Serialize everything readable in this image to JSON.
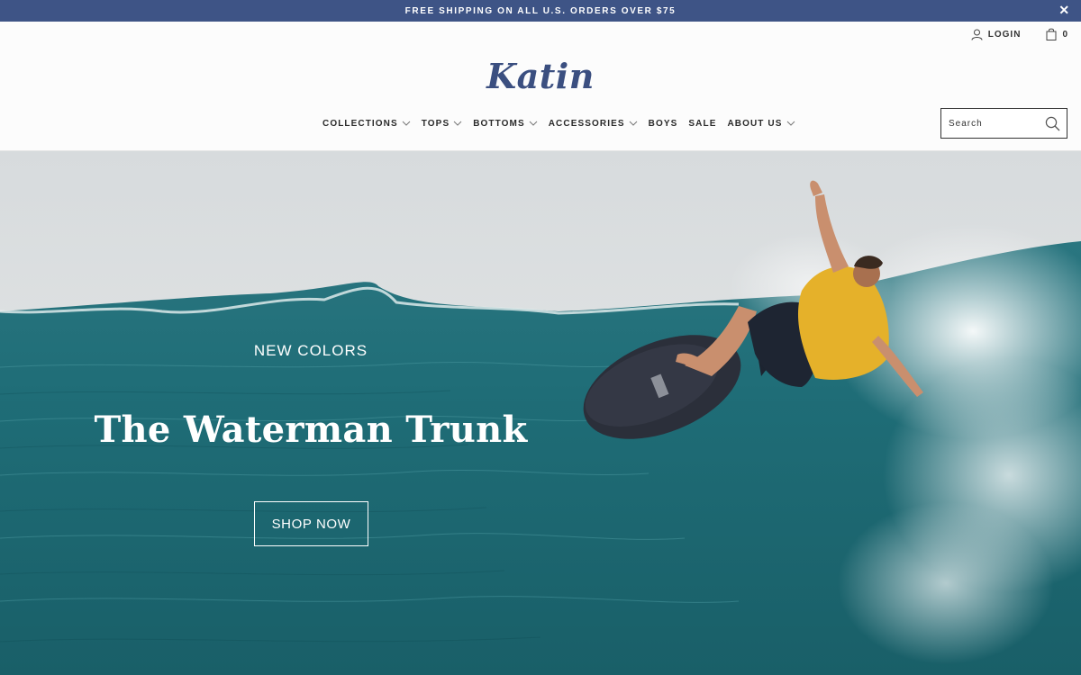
{
  "announcement": {
    "text": "FREE SHIPPING ON ALL U.S. ORDERS OVER $75",
    "close_icon": "close-icon",
    "close_symbol": "✕"
  },
  "header": {
    "login_label": "LOGIN",
    "login_icon": "user-icon",
    "cart_icon": "shopping-bag-icon",
    "cart_count": "0",
    "logo_text": "Katin",
    "brand_color": "#3b4f80",
    "announce_color": "#3e5486"
  },
  "nav": {
    "items": [
      {
        "label": "COLLECTIONS",
        "has_dropdown": true
      },
      {
        "label": "TOPS",
        "has_dropdown": true
      },
      {
        "label": "BOTTOMS",
        "has_dropdown": true
      },
      {
        "label": "ACCESSORIES",
        "has_dropdown": true
      },
      {
        "label": "BOYS",
        "has_dropdown": false
      },
      {
        "label": "SALE",
        "has_dropdown": false
      },
      {
        "label": "ABOUT US",
        "has_dropdown": true
      }
    ]
  },
  "search": {
    "placeholder": "Search",
    "icon": "search-icon"
  },
  "hero": {
    "kicker": "NEW COLORS",
    "title": "The Waterman Trunk",
    "cta_label": "SHOP NOW",
    "image": "surfer-wave-photo"
  }
}
